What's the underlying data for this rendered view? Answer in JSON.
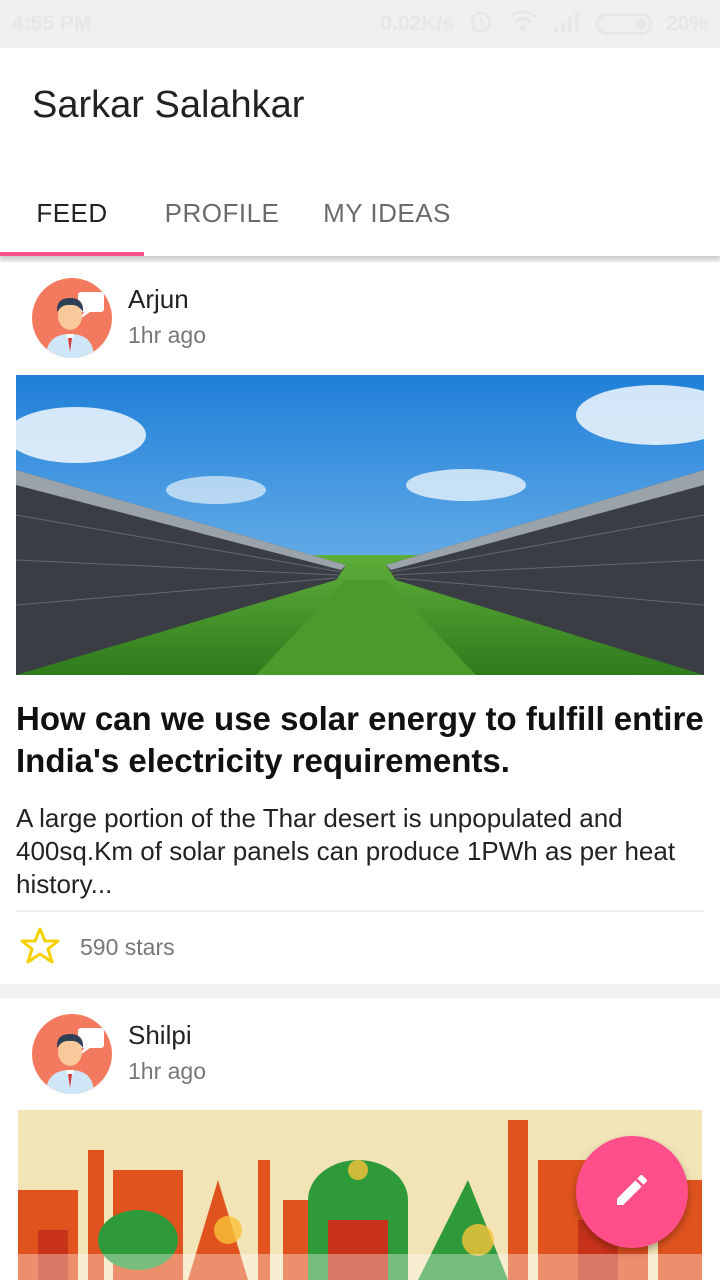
{
  "status_bar": {
    "time": "4:55 PM",
    "speed": "0.02K/s",
    "battery": "20%"
  },
  "app": {
    "title": "Sarkar Salahkar"
  },
  "tabs": [
    {
      "label": "FEED",
      "active": true
    },
    {
      "label": "PROFILE",
      "active": false
    },
    {
      "label": "MY IDEAS",
      "active": false
    }
  ],
  "posts": [
    {
      "author": "Arjun",
      "time": "1hr ago",
      "title": "How can we use solar energy to fulfill entire India's electricity requirements.",
      "body": "A large portion of the Thar desert is unpopulated and 400sq.Km of solar panels can produce 1PWh as per heat history...",
      "stars": "590 stars"
    },
    {
      "author": "Shilpi",
      "time": "1hr ago"
    }
  ],
  "colors": {
    "accent": "#ff4f8b",
    "star": "#f5d000",
    "avatar_bg": "#f37a5e"
  },
  "icons": {
    "fab": "edit-pencil-icon",
    "star": "star-outline-icon"
  }
}
